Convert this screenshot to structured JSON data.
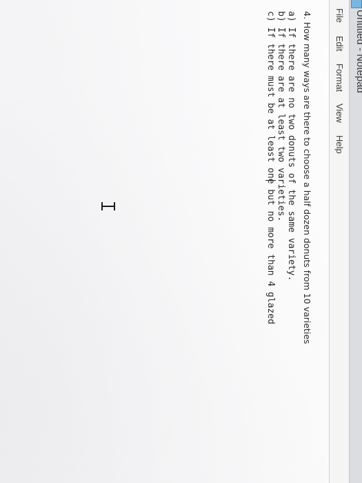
{
  "window": {
    "title": "Untitled - Notepad",
    "icon": "notepad-icon"
  },
  "menubar": {
    "file": "File",
    "edit": "Edit",
    "format": "Format",
    "view": "View",
    "help": "Help"
  },
  "document": {
    "question": "4. How many ways are there to choose a half dozen donuts from 10 varieties",
    "part_a": "a) If there are no two donuts of the same variety.",
    "part_b": "b) If there are at least two varieties.",
    "part_c": "c) If there must be at least one but no more than 4 glazed"
  },
  "cursor": {
    "type": "ibeam-cursor-icon"
  }
}
